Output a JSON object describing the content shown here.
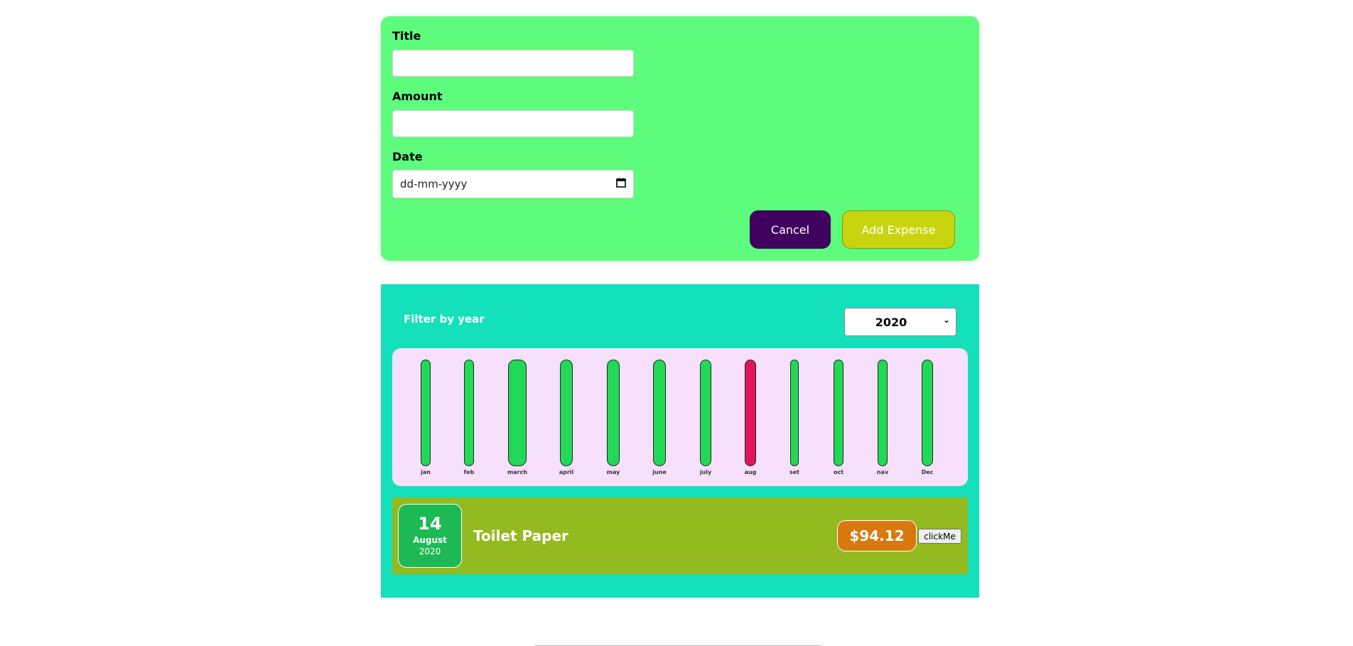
{
  "form": {
    "title_label": "Title",
    "title_value": "",
    "amount_label": "Amount",
    "amount_value": "",
    "date_label": "Date",
    "date_placeholder": "dd-mm-yyyy",
    "cancel_label": "Cancel",
    "add_label": "Add Expense"
  },
  "filter": {
    "label": "Filter by year",
    "selected_year": "2020"
  },
  "chart_data": {
    "type": "bar",
    "categories": [
      "jan",
      "feb",
      "march",
      "april",
      "may",
      "june",
      "july",
      "aug",
      "set",
      "oct",
      "nav",
      "Dec"
    ],
    "values": [
      100,
      100,
      100,
      100,
      100,
      100,
      100,
      100,
      100,
      100,
      100,
      100
    ],
    "highlighted": "aug",
    "colors": {
      "default": "#22d957",
      "highlight": "#e0155a"
    }
  },
  "expenses": [
    {
      "day": "14",
      "month": "August",
      "year": "2020",
      "title": "Toilet Paper",
      "amount": "$94.12",
      "action_label": "clickMe"
    }
  ],
  "colors": {
    "form_bg": "#5efc7d",
    "list_bg": "#14e0bb",
    "chart_bg": "#f7e0fc",
    "item_bg": "#93ba1f",
    "cancel": "#40005d",
    "add": "#c8d40e",
    "price": "#d8780e"
  }
}
